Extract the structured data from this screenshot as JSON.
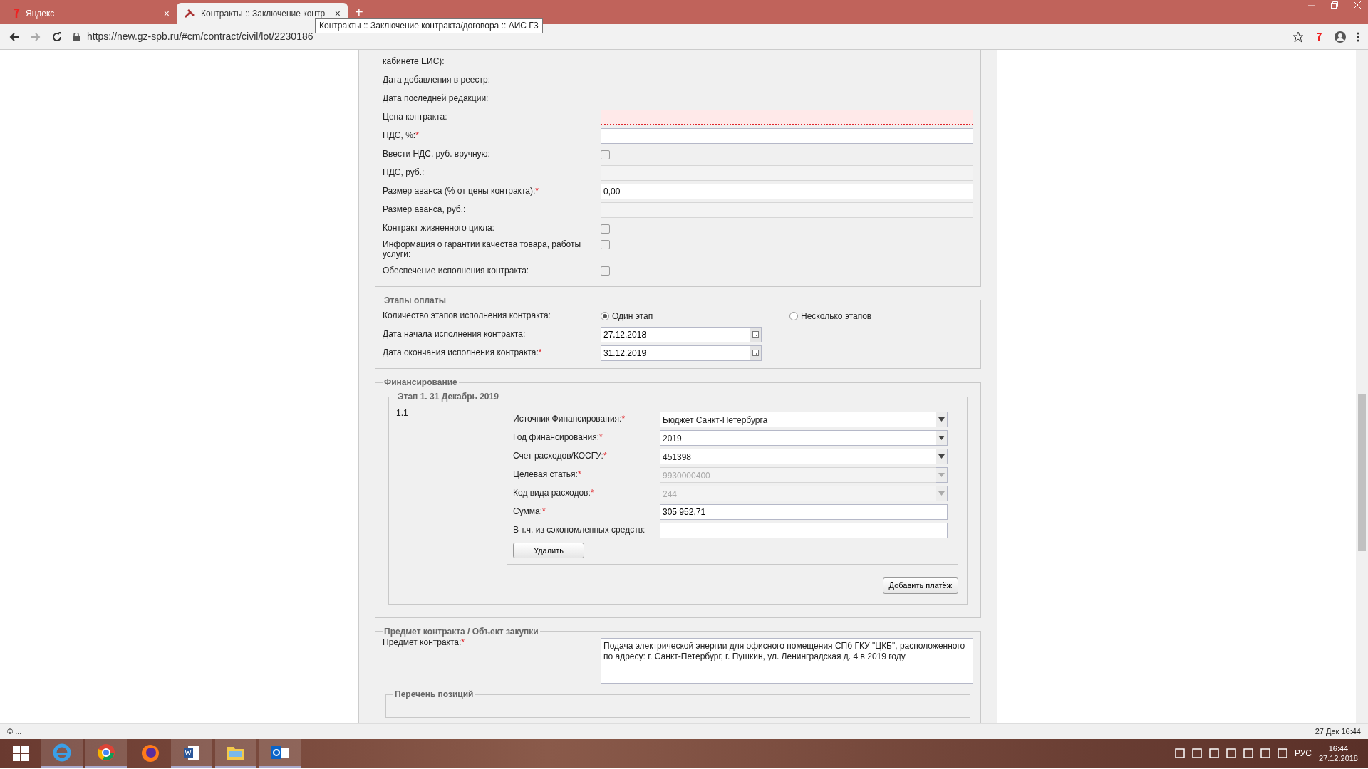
{
  "browser": {
    "tabs": [
      {
        "title": "Яндекс",
        "close": "×",
        "selected": false
      },
      {
        "title": "Контракты :: Заключение контр",
        "close": "×",
        "selected": true
      }
    ],
    "new_tab": "+",
    "tooltip": "Контракты :: Заключение контракта/договора :: АИС ГЗ",
    "url": "https://new.gz-spb.ru/#cm/contract/civil/lot/2230186"
  },
  "main_fields": [
    {
      "label": "кабинете ЕИС):",
      "kind": "none"
    },
    {
      "label": "Дата добавления в реестр:",
      "kind": "none"
    },
    {
      "label": "Дата последней редакции:",
      "kind": "none"
    },
    {
      "label": "Цена контракта:",
      "kind": "text",
      "invalid": true,
      "disabled": false
    },
    {
      "label": "НДС, %:",
      "marker": "*",
      "kind": "text",
      "invalid": false,
      "disabled": false
    },
    {
      "label": "Ввести НДС, руб. вручную:",
      "kind": "checkbox",
      "checked": false
    },
    {
      "label": "НДС, руб.:",
      "kind": "text",
      "invalid": false,
      "disabled": true
    },
    {
      "label": "Размер аванса (% от цены контракта):",
      "marker": "*",
      "kind": "text",
      "invalid": false,
      "disabled": false,
      "value": "0,00"
    },
    {
      "label": "Размер аванса, руб.:",
      "kind": "text",
      "invalid": false,
      "disabled": true
    },
    {
      "label": "Контракт жизненного цикла:",
      "kind": "checkbox",
      "checked": false
    },
    {
      "label": "Информация о гарантии качества товара, работы услуги:",
      "kind": "checkbox",
      "checked": false
    },
    {
      "label": "Обеспечение исполнения контракта:",
      "kind": "checkbox",
      "checked": false
    }
  ],
  "payment_stages": {
    "legend": "Этапы оплаты",
    "count_label": "Количество этапов исполнения контракта:",
    "options": [
      {
        "label": "Один этап",
        "selected": true
      },
      {
        "label": "Несколько этапов",
        "selected": false
      }
    ],
    "dates": [
      {
        "label": "Дата начала исполнения контракта:",
        "value": "27.12.2018"
      },
      {
        "label": "Дата окончания исполнения контракта:",
        "marker": "*",
        "value": "31.12.2019"
      }
    ]
  },
  "financing": {
    "legend": "Финансирование",
    "stage_legend": "Этап 1. 31 Декабрь 2019",
    "number": "1.1",
    "fields": [
      {
        "label": "Источник Финансирования:",
        "marker": "*",
        "kind": "select",
        "value": "Бюджет Санкт-Петербурга",
        "disabled": false
      },
      {
        "label": "Год финансирования:",
        "marker": "*",
        "kind": "select",
        "value": "2019",
        "disabled": false
      },
      {
        "label": "Счет расходов/КОСГУ:",
        "marker": "*",
        "kind": "select",
        "value": "451398",
        "disabled": false
      },
      {
        "label": "Целевая статья:",
        "marker": "*",
        "kind": "select",
        "value": "9930000400",
        "disabled": true
      },
      {
        "label": "Код вида расходов:",
        "marker": "*",
        "kind": "select",
        "value": "244",
        "disabled": true
      },
      {
        "label": "Сумма:",
        "marker": "*",
        "kind": "text",
        "value": "305 952,71",
        "disabled": false
      },
      {
        "label": "В т.ч. из сэкономленных средств:",
        "kind": "text",
        "disabled": false
      }
    ],
    "delete_button": "Удалить",
    "add_button": "Добавить платёж"
  },
  "subject": {
    "legend": "Предмет контракта / Объект закупки",
    "label": "Предмет контракта:",
    "marker": "*",
    "value": "Подача электрической энергии для офисного помещения СПб ГКУ \"ЦКБ\", расположенного по адресу: г. Санкт-Петербург, г. Пушкин, ул. Ленинградская д. 4 в 2019 году",
    "positions_legend": "Перечень позиций"
  },
  "status_bar": {
    "left": "© ...",
    "right": "27 Дек 16:44"
  },
  "taskbar": {
    "language": "РУС",
    "time": "16:44",
    "date": "27.12.2018"
  }
}
